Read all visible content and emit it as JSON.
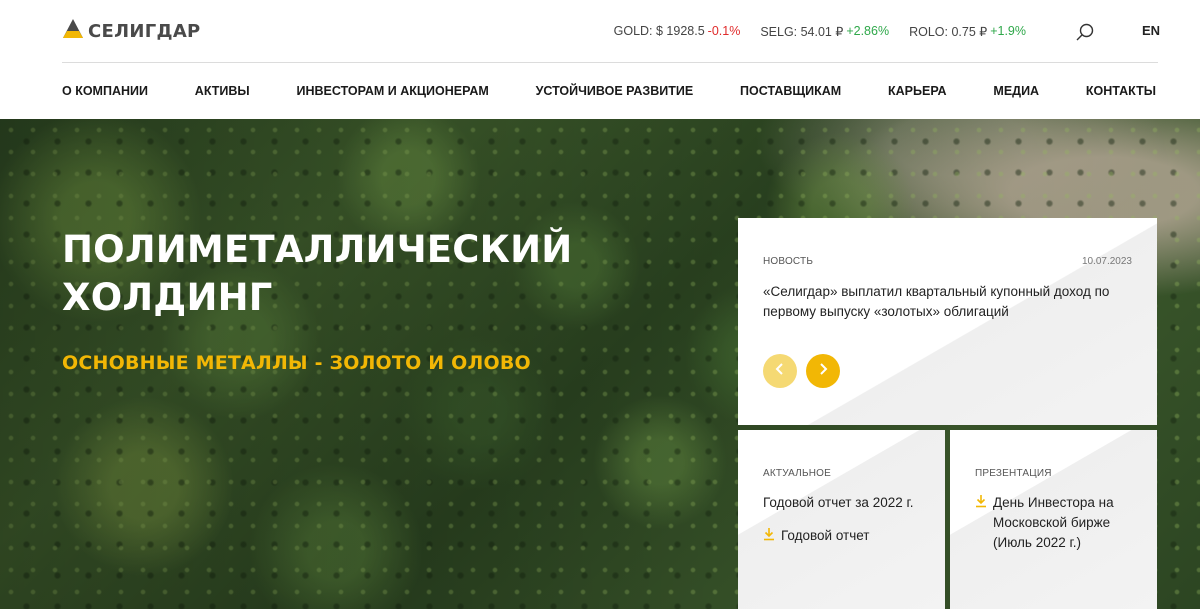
{
  "header": {
    "logo_text": "СЕЛИГДАР",
    "tickers": [
      {
        "label": "GOLD: $ 1928.5",
        "change": "-0.1%",
        "direction": "down"
      },
      {
        "label": "SELG: 54.01 ₽",
        "change": "+2.86%",
        "direction": "up"
      },
      {
        "label": "ROLO: 0.75 ₽",
        "change": "+1.9%",
        "direction": "up"
      }
    ],
    "search_icon": "search-icon",
    "lang": "EN"
  },
  "nav": {
    "items": [
      "О КОМПАНИИ",
      "АКТИВЫ",
      "ИНВЕСТОРАМ И АКЦИОНЕРАМ",
      "УСТОЙЧИВОЕ РАЗВИТИЕ",
      "ПОСТАВЩИКАМ",
      "КАРЬЕРА",
      "МЕДИА",
      "КОНТАКТЫ"
    ]
  },
  "hero": {
    "title": "ПОЛИМЕТАЛЛИЧЕСКИЙ ХОЛДИНГ",
    "subtitle": "ОСНОВНЫЕ МЕТАЛЛЫ - ЗОЛОТО И ОЛОВО"
  },
  "news_card": {
    "label": "НОВОСТЬ",
    "date": "10.07.2023",
    "text": "«Селигдар» выплатил квартальный купонный доход по первому выпуску «золотых» облигаций",
    "prev_icon": "chevron-left-icon",
    "next_icon": "chevron-right-icon"
  },
  "actual_card": {
    "label": "АКТУАЛЬНОЕ",
    "title": "Годовой отчет за 2022 г.",
    "link": "Годовой отчет",
    "link_icon": "download-icon"
  },
  "presentation_card": {
    "label": "ПРЕЗЕНТАЦИЯ",
    "link": "День Инвестора на Московской бирже (Июль 2022 г.)",
    "link_icon": "download-icon"
  },
  "colors": {
    "accent": "#f2b705",
    "accent_light": "#f5d973",
    "negative": "#e02b2b",
    "positive": "#2fa84a"
  }
}
